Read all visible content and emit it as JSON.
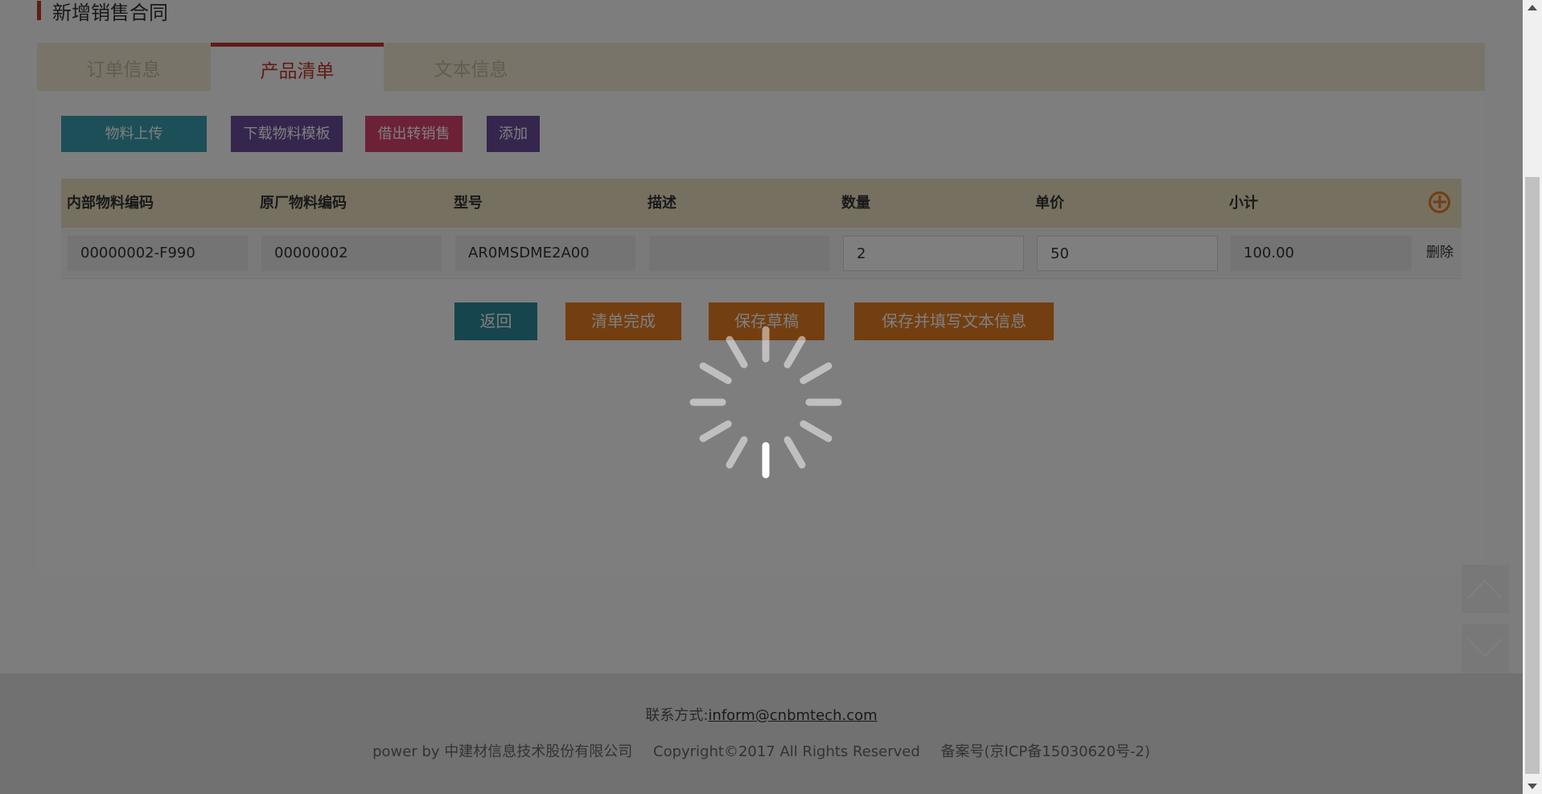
{
  "page": {
    "title": "新增销售合同"
  },
  "tabs": [
    {
      "label": "订单信息",
      "active": false
    },
    {
      "label": "产品清单",
      "active": true
    },
    {
      "label": "文本信息",
      "active": false
    }
  ],
  "toolbar": {
    "upload_label": "物料上传",
    "download_template_label": "下载物料模板",
    "loan_to_sale_label": "借出转销售",
    "add_label": "添加"
  },
  "table": {
    "headers": [
      "内部物料编码",
      "原厂物料编码",
      "型号",
      "描述",
      "数量",
      "单价",
      "小计"
    ],
    "rows": [
      {
        "internal_code": "00000002-F990",
        "factory_code": "00000002",
        "model": "AR0MSDME2A00",
        "description": "",
        "quantity": "2",
        "unit_price": "50",
        "subtotal": "100.00",
        "delete_label": "删除"
      }
    ]
  },
  "actions": {
    "back_label": "返回",
    "complete_label": "清单完成",
    "save_draft_label": "保存草稿",
    "save_and_text_label": "保存并填写文本信息"
  },
  "footer": {
    "contact_label": "联系方式:",
    "contact_email": "inform@cnbmtech.com",
    "powered_by": "power by 中建材信息技术股份有限公司",
    "copyright": "Copyright©2017 All Rights Reserved",
    "icp": "备案号(京ICP备15030620号-2)"
  },
  "colors": {
    "accent_red": "#c0392b",
    "teal": "#3a9fb0",
    "purple": "#6a4c9c",
    "pink": "#d9426d",
    "orange": "#e67e22",
    "dark_teal": "#2e8a9a",
    "tab_bar": "#f3e8d2"
  },
  "state": {
    "loading": true
  }
}
